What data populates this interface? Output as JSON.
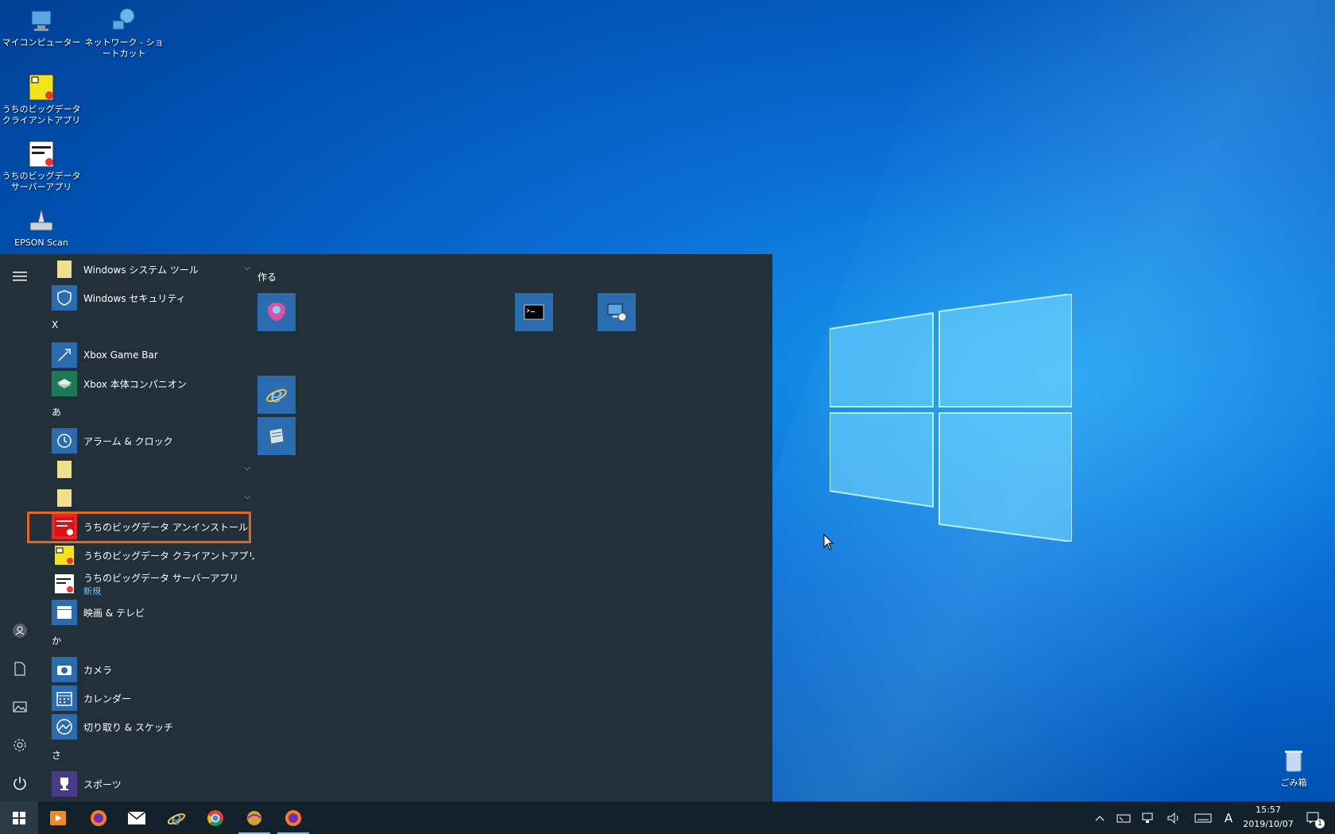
{
  "desktop": {
    "icons": [
      {
        "label": "マイコンピューター",
        "icon": "computer-icon"
      },
      {
        "label": "ネットワーク - ショートカット",
        "icon": "network-icon"
      },
      {
        "label": "うちのビッグデータ クライアントアプリ",
        "icon": "client-app-icon"
      },
      {
        "label": "うちのビッグデータ サーバーアプリ",
        "icon": "server-app-icon"
      },
      {
        "label": "EPSON Scan",
        "icon": "scanner-icon"
      },
      {
        "label": "ごみ箱",
        "icon": "recycle-bin-icon"
      }
    ]
  },
  "start_menu": {
    "apps": [
      {
        "label": "Windows システム ツール",
        "icon": "folder-icon",
        "expandable": true
      },
      {
        "label": "Windows セキュリティ",
        "icon": "shield-icon"
      },
      {
        "letter": "X"
      },
      {
        "label": "Xbox Game Bar",
        "icon": "xbox-game-bar-icon"
      },
      {
        "label": "Xbox 本体コンパニオン",
        "icon": "xbox-companion-icon"
      },
      {
        "letter": "あ"
      },
      {
        "label": "アラーム & クロック",
        "icon": "alarm-clock-icon"
      },
      {
        "label": "",
        "icon": "folder-icon",
        "expandable": true
      },
      {
        "label": "",
        "icon": "folder-icon",
        "expandable": true
      },
      {
        "label": "うちのビッグデータ アンインストール",
        "icon": "uninstall-icon",
        "highlighted": true
      },
      {
        "label": "うちのビッグデータ クライアントアプリ",
        "icon": "client-app-icon"
      },
      {
        "label": "うちのビッグデータ サーバーアプリ",
        "sublabel": "新規",
        "icon": "server-app-icon"
      },
      {
        "label": "映画 & テレビ",
        "icon": "movies-tv-icon"
      },
      {
        "letter": "か"
      },
      {
        "label": "カメラ",
        "icon": "camera-icon"
      },
      {
        "label": "カレンダー",
        "icon": "calendar-icon"
      },
      {
        "label": "切り取り & スケッチ",
        "icon": "snip-sketch-icon"
      },
      {
        "letter": "さ"
      },
      {
        "label": "スポーツ",
        "icon": "trophy-icon"
      }
    ],
    "tile_group_title": "作る",
    "tiles": [
      "paint3d-icon",
      "cmd-icon",
      "remote-desktop-icon",
      "ie-icon",
      "notepad-icon"
    ],
    "rail": [
      "hamburger-icon",
      "user-icon",
      "documents-icon",
      "pictures-icon",
      "settings-icon",
      "power-icon"
    ]
  },
  "taskbar": {
    "pinned": [
      "start-icon",
      "media-player-icon",
      "firefox-icon",
      "mail-icon",
      "ie-icon",
      "chrome-icon",
      "app-icon",
      "firefox-icon"
    ],
    "tray": {
      "ime": "A",
      "time": "15:57",
      "date": "2019/10/07",
      "notification_count": "1"
    }
  },
  "colors": {
    "start_bg": "#22303a",
    "taskbar_bg": "#13212a",
    "highlight": "#e2671d",
    "tile": "#2b6cb0"
  }
}
